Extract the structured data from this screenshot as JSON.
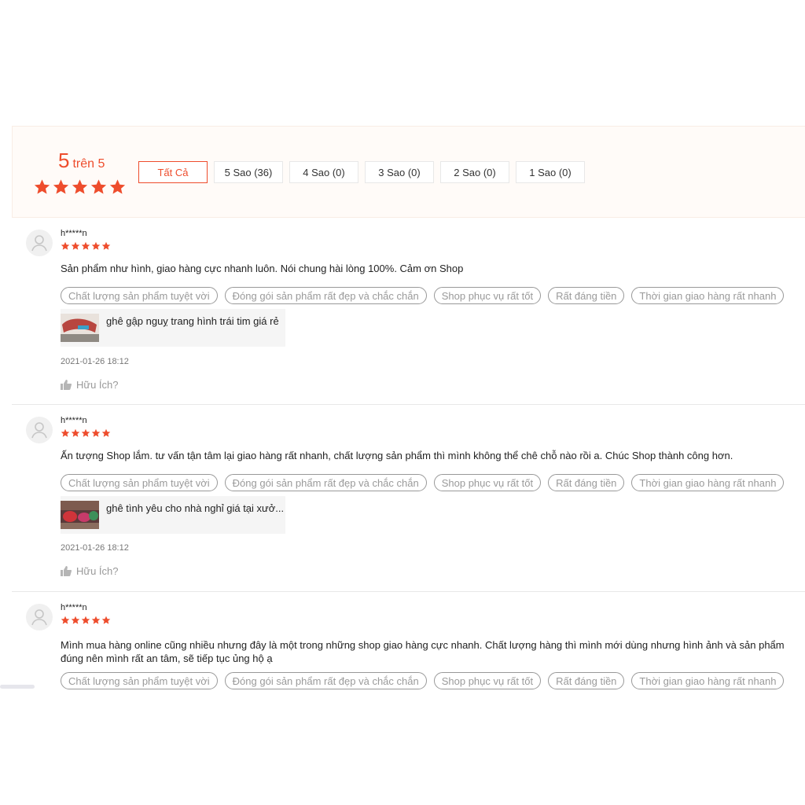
{
  "rating": {
    "score": "5",
    "suffix": "trên 5",
    "stars": 5
  },
  "filters": [
    "Tất Cả",
    "5 Sao (36)",
    "4 Sao (0)",
    "3 Sao (0)",
    "2 Sao (0)",
    "1 Sao (0)"
  ],
  "colors": {
    "accent": "#ee4d2d"
  },
  "reviews": [
    {
      "author": "h*****n",
      "stars": 5,
      "comment": "Sản phẩm như hình, giao hàng cực nhanh luôn. Nói chung hài lòng 100%. Cảm ơn Shop",
      "tags": [
        "Chất lượng sản phẩm tuyệt vời",
        "Đóng gói sản phẩm rất đẹp và chắc chắn",
        "Shop phục vụ rất tốt",
        "Rất đáng tiền",
        "Thời gian giao hàng rất nhanh"
      ],
      "product_name": "ghê gập nguỵ trang hình trái tim giá rẻ",
      "time": "2021-01-26 18:12",
      "helpful": "Hữu Ích?"
    },
    {
      "author": "h*****n",
      "stars": 5,
      "comment": "Ấn tượng Shop lắm. tư vấn tận tâm lại giao hàng rất nhanh, chất lượng sản phẩm thì mình không thể chê chỗ nào rồi a. Chúc Shop thành công hơn.",
      "tags": [
        "Chất lượng sản phẩm tuyệt vời",
        "Đóng gói sản phẩm rất đẹp và chắc chắn",
        "Shop phục vụ rất tốt",
        "Rất đáng tiền",
        "Thời gian giao hàng rất nhanh"
      ],
      "product_name": "ghê tình yêu cho nhà nghỉ giá tại xưở...",
      "time": "2021-01-26 18:12",
      "helpful": "Hữu Ích?"
    },
    {
      "author": "h*****n",
      "stars": 5,
      "comment": "Mình mua hàng online cũng nhiều nhưng đây là một trong những shop giao hàng cực nhanh. Chất lượng hàng thì mình mới dùng nhưng hình ảnh và sản phẩm đúng nên mình rất an tâm, sẽ tiếp tục ủng hộ ạ",
      "tags": [
        "Chất lượng sản phẩm tuyệt vời",
        "Đóng gói sản phẩm rất đẹp và chắc chắn",
        "Shop phục vụ rất tốt",
        "Rất đáng tiền",
        "Thời gian giao hàng rất nhanh"
      ]
    }
  ]
}
